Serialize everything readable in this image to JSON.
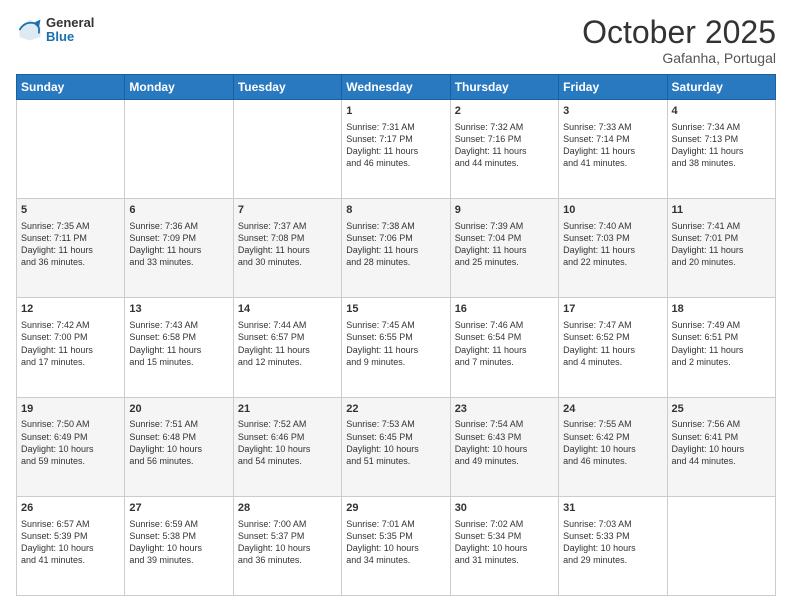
{
  "header": {
    "logo_general": "General",
    "logo_blue": "Blue",
    "month_title": "October 2025",
    "location": "Gafanha, Portugal"
  },
  "days_of_week": [
    "Sunday",
    "Monday",
    "Tuesday",
    "Wednesday",
    "Thursday",
    "Friday",
    "Saturday"
  ],
  "weeks": [
    {
      "cells": [
        {
          "day": null,
          "data": null
        },
        {
          "day": null,
          "data": null
        },
        {
          "day": null,
          "data": null
        },
        {
          "day": "1",
          "data": "Sunrise: 7:31 AM\nSunset: 7:17 PM\nDaylight: 11 hours\nand 46 minutes."
        },
        {
          "day": "2",
          "data": "Sunrise: 7:32 AM\nSunset: 7:16 PM\nDaylight: 11 hours\nand 44 minutes."
        },
        {
          "day": "3",
          "data": "Sunrise: 7:33 AM\nSunset: 7:14 PM\nDaylight: 11 hours\nand 41 minutes."
        },
        {
          "day": "4",
          "data": "Sunrise: 7:34 AM\nSunset: 7:13 PM\nDaylight: 11 hours\nand 38 minutes."
        }
      ]
    },
    {
      "cells": [
        {
          "day": "5",
          "data": "Sunrise: 7:35 AM\nSunset: 7:11 PM\nDaylight: 11 hours\nand 36 minutes."
        },
        {
          "day": "6",
          "data": "Sunrise: 7:36 AM\nSunset: 7:09 PM\nDaylight: 11 hours\nand 33 minutes."
        },
        {
          "day": "7",
          "data": "Sunrise: 7:37 AM\nSunset: 7:08 PM\nDaylight: 11 hours\nand 30 minutes."
        },
        {
          "day": "8",
          "data": "Sunrise: 7:38 AM\nSunset: 7:06 PM\nDaylight: 11 hours\nand 28 minutes."
        },
        {
          "day": "9",
          "data": "Sunrise: 7:39 AM\nSunset: 7:04 PM\nDaylight: 11 hours\nand 25 minutes."
        },
        {
          "day": "10",
          "data": "Sunrise: 7:40 AM\nSunset: 7:03 PM\nDaylight: 11 hours\nand 22 minutes."
        },
        {
          "day": "11",
          "data": "Sunrise: 7:41 AM\nSunset: 7:01 PM\nDaylight: 11 hours\nand 20 minutes."
        }
      ]
    },
    {
      "cells": [
        {
          "day": "12",
          "data": "Sunrise: 7:42 AM\nSunset: 7:00 PM\nDaylight: 11 hours\nand 17 minutes."
        },
        {
          "day": "13",
          "data": "Sunrise: 7:43 AM\nSunset: 6:58 PM\nDaylight: 11 hours\nand 15 minutes."
        },
        {
          "day": "14",
          "data": "Sunrise: 7:44 AM\nSunset: 6:57 PM\nDaylight: 11 hours\nand 12 minutes."
        },
        {
          "day": "15",
          "data": "Sunrise: 7:45 AM\nSunset: 6:55 PM\nDaylight: 11 hours\nand 9 minutes."
        },
        {
          "day": "16",
          "data": "Sunrise: 7:46 AM\nSunset: 6:54 PM\nDaylight: 11 hours\nand 7 minutes."
        },
        {
          "day": "17",
          "data": "Sunrise: 7:47 AM\nSunset: 6:52 PM\nDaylight: 11 hours\nand 4 minutes."
        },
        {
          "day": "18",
          "data": "Sunrise: 7:49 AM\nSunset: 6:51 PM\nDaylight: 11 hours\nand 2 minutes."
        }
      ]
    },
    {
      "cells": [
        {
          "day": "19",
          "data": "Sunrise: 7:50 AM\nSunset: 6:49 PM\nDaylight: 10 hours\nand 59 minutes."
        },
        {
          "day": "20",
          "data": "Sunrise: 7:51 AM\nSunset: 6:48 PM\nDaylight: 10 hours\nand 56 minutes."
        },
        {
          "day": "21",
          "data": "Sunrise: 7:52 AM\nSunset: 6:46 PM\nDaylight: 10 hours\nand 54 minutes."
        },
        {
          "day": "22",
          "data": "Sunrise: 7:53 AM\nSunset: 6:45 PM\nDaylight: 10 hours\nand 51 minutes."
        },
        {
          "day": "23",
          "data": "Sunrise: 7:54 AM\nSunset: 6:43 PM\nDaylight: 10 hours\nand 49 minutes."
        },
        {
          "day": "24",
          "data": "Sunrise: 7:55 AM\nSunset: 6:42 PM\nDaylight: 10 hours\nand 46 minutes."
        },
        {
          "day": "25",
          "data": "Sunrise: 7:56 AM\nSunset: 6:41 PM\nDaylight: 10 hours\nand 44 minutes."
        }
      ]
    },
    {
      "cells": [
        {
          "day": "26",
          "data": "Sunrise: 6:57 AM\nSunset: 5:39 PM\nDaylight: 10 hours\nand 41 minutes."
        },
        {
          "day": "27",
          "data": "Sunrise: 6:59 AM\nSunset: 5:38 PM\nDaylight: 10 hours\nand 39 minutes."
        },
        {
          "day": "28",
          "data": "Sunrise: 7:00 AM\nSunset: 5:37 PM\nDaylight: 10 hours\nand 36 minutes."
        },
        {
          "day": "29",
          "data": "Sunrise: 7:01 AM\nSunset: 5:35 PM\nDaylight: 10 hours\nand 34 minutes."
        },
        {
          "day": "30",
          "data": "Sunrise: 7:02 AM\nSunset: 5:34 PM\nDaylight: 10 hours\nand 31 minutes."
        },
        {
          "day": "31",
          "data": "Sunrise: 7:03 AM\nSunset: 5:33 PM\nDaylight: 10 hours\nand 29 minutes."
        },
        {
          "day": null,
          "data": null
        }
      ]
    }
  ]
}
